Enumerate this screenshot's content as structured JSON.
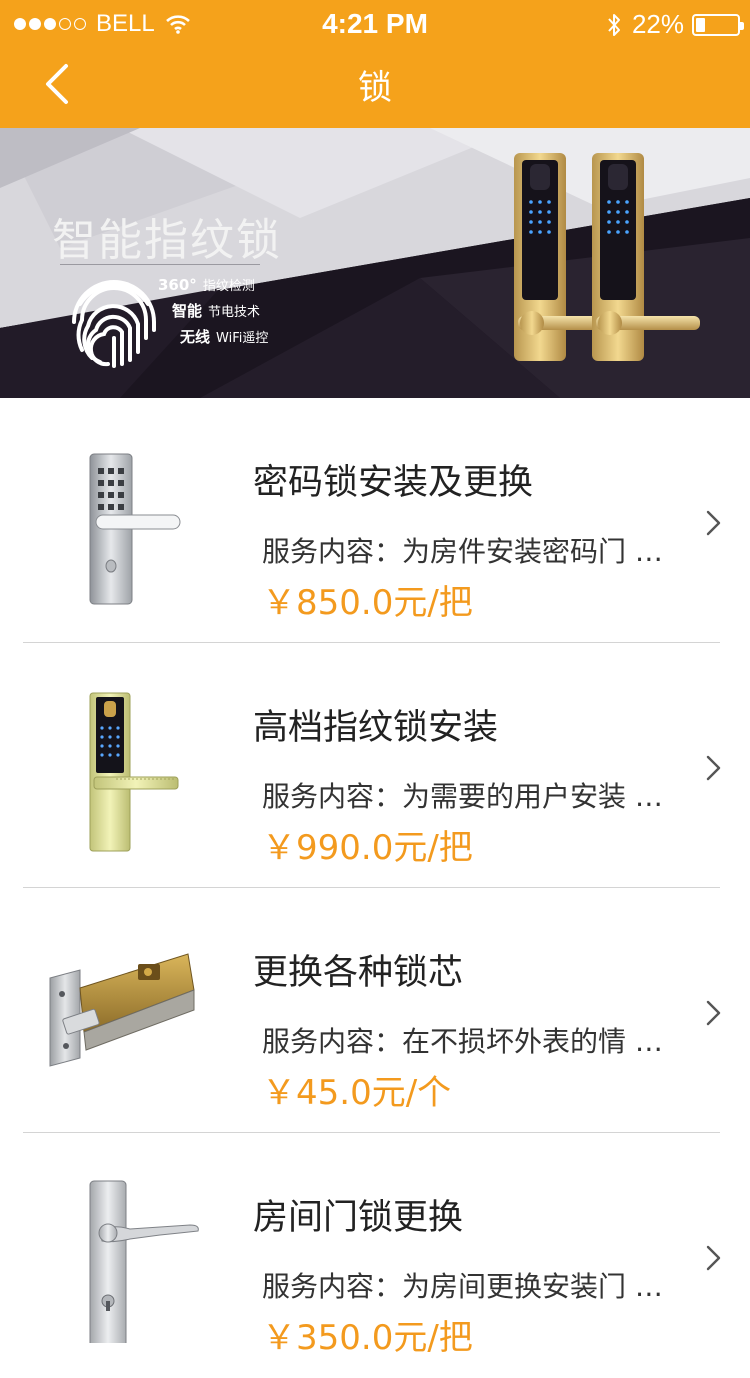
{
  "status_bar": {
    "carrier": "BELL",
    "time": "4:21 PM",
    "battery_percent": "22%",
    "battery_level": 0.22,
    "signal_icons": [
      "signal-dots-icon",
      "wifi-icon",
      "bluetooth-icon",
      "battery-icon"
    ]
  },
  "nav": {
    "title": "锁",
    "back_icon": "chevron-left-icon"
  },
  "banner": {
    "title": "智能指纹锁",
    "features": [
      {
        "bold": "360°",
        "text": "指纹检测"
      },
      {
        "bold": "智能",
        "text": "节电技术"
      },
      {
        "bold": "无线",
        "text": "WiFi遥控"
      }
    ]
  },
  "services": [
    {
      "title": "密码锁安装及更换",
      "desc": "服务内容：为房件安装密码门 …",
      "price": "￥850.0元/把",
      "thumb": "keypad-lock"
    },
    {
      "title": "高档指纹锁安装",
      "desc": "服务内容：为需要的用户安装 …",
      "price": "￥990.0元/把",
      "thumb": "fingerprint-lock"
    },
    {
      "title": "更换各种锁芯",
      "desc": "服务内容：在不损坏外表的情 …",
      "price": "￥45.0元/个",
      "thumb": "lock-cylinder"
    },
    {
      "title": "房间门锁更换",
      "desc": "服务内容：为房间更换安装门 …",
      "price": "￥350.0元/把",
      "thumb": "lever-handle-lock"
    }
  ],
  "colors": {
    "accent": "#f5a21b",
    "price": "#f39a1e",
    "separator": "#d4d4d4"
  }
}
